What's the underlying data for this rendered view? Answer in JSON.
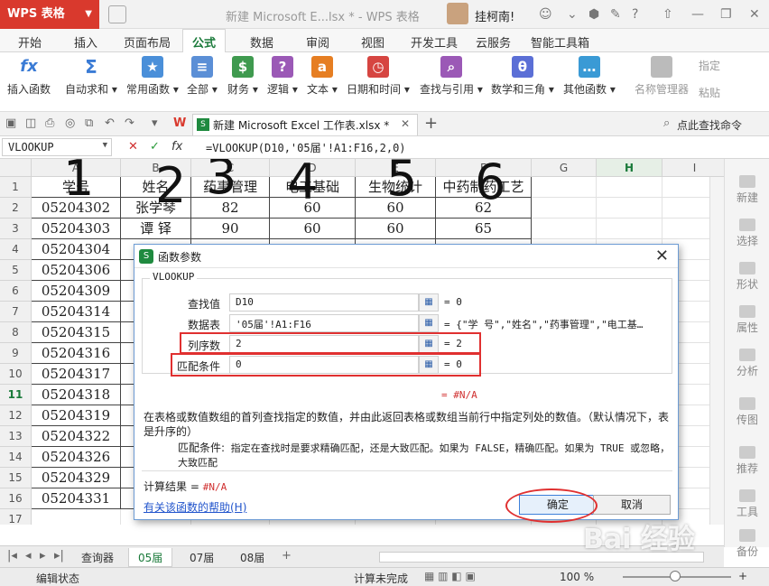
{
  "titlebar": {
    "app": "WPS 表格",
    "doc_title": "新建 Microsoft E...lsx * - WPS 表格",
    "user": "挂柯南!"
  },
  "menu": [
    "开始",
    "插入",
    "页面布局",
    "公式",
    "数据",
    "审阅",
    "视图",
    "开发工具",
    "云服务",
    "智能工具箱"
  ],
  "active_menu": "公式",
  "ribbon": [
    {
      "label": "插入函数",
      "icon": "fx",
      "color": "#3a7bd5"
    },
    {
      "label": "自动求和 ▾",
      "icon": "Σ",
      "color": "#3a7bd5"
    },
    {
      "label": "常用函数 ▾",
      "icon": "★",
      "color": "#4a8fd9"
    },
    {
      "label": "全部 ▾",
      "icon": "≡",
      "color": "#5b8fd6"
    },
    {
      "label": "财务 ▾",
      "icon": "$",
      "color": "#3f9a4f"
    },
    {
      "label": "逻辑 ▾",
      "icon": "?",
      "color": "#9b59b6"
    },
    {
      "label": "文本 ▾",
      "icon": "a",
      "color": "#e67e22"
    },
    {
      "label": "日期和时间 ▾",
      "icon": "◷",
      "color": "#d64541"
    },
    {
      "label": "查找与引用 ▾",
      "icon": "⌕",
      "color": "#9b59b6"
    },
    {
      "label": "数学和三角 ▾",
      "icon": "θ",
      "color": "#5b6fd6"
    },
    {
      "label": "其他函数 ▾",
      "icon": "…",
      "color": "#3a9ad5"
    }
  ],
  "ribbon_right": {
    "name_manager": "名称管理器",
    "paste": "粘贴",
    "specify": "指定"
  },
  "workbook_tab": "新建 Microsoft Excel 工作表.xlsx *",
  "search_cmd": "点此查找命令",
  "namebox": "VLOOKUP",
  "formula": "=VLOOKUP(D10,'05届'!A1:F16,2,0)",
  "columns": [
    "A",
    "B",
    "C",
    "D",
    "E",
    "F",
    "G",
    "H",
    "I"
  ],
  "rows": [
    "1",
    "2",
    "3",
    "4",
    "5",
    "6",
    "7",
    "8",
    "9",
    "10",
    "11",
    "12",
    "13",
    "14",
    "15",
    "16",
    "17"
  ],
  "table": [
    [
      "学号",
      "姓名",
      "药事管理",
      "电工基础",
      "生物统计",
      "中药制药工艺"
    ],
    [
      "05204302",
      "张学琴",
      "82",
      "60",
      "60",
      "62"
    ],
    [
      "05204303",
      "谭 铎",
      "90",
      "60",
      "60",
      "65"
    ],
    [
      "05204304",
      "",
      "",
      "",
      "",
      ""
    ],
    [
      "05204306",
      "",
      "",
      "",
      "",
      ""
    ],
    [
      "05204309",
      "",
      "",
      "",
      "",
      ""
    ],
    [
      "05204314",
      "",
      "",
      "",
      "",
      ""
    ],
    [
      "05204315",
      "",
      "",
      "",
      "",
      ""
    ],
    [
      "05204316",
      "",
      "",
      "",
      "",
      ""
    ],
    [
      "05204317",
      "",
      "",
      "",
      "",
      ""
    ],
    [
      "05204318",
      "",
      "",
      "",
      "",
      ""
    ],
    [
      "05204319",
      "",
      "",
      "",
      "",
      ""
    ],
    [
      "05204322",
      "",
      "",
      "",
      "",
      ""
    ],
    [
      "05204326",
      "",
      "",
      "",
      "",
      ""
    ],
    [
      "05204329",
      "",
      "",
      "",
      "",
      ""
    ],
    [
      "05204331",
      "",
      "",
      "",
      "",
      ""
    ]
  ],
  "handwritten": [
    "1",
    "2",
    "3",
    "4",
    "5",
    "6"
  ],
  "side_panel": [
    "新建",
    "选择",
    "形状",
    "属性",
    "分析",
    "传图",
    "推荐",
    "工具",
    "备份"
  ],
  "sheets": [
    "查询器",
    "05届",
    "07届",
    "08届"
  ],
  "active_sheet": "05届",
  "status": {
    "mode": "编辑状态",
    "calc": "计算未完成",
    "zoom": "100 %"
  },
  "dialog": {
    "title": "函数参数",
    "func": "VLOOKUP",
    "args": [
      {
        "label": "查找值",
        "value": "D10",
        "result": "= 0"
      },
      {
        "label": "数据表",
        "value": "'05届'!A1:F16",
        "result": "= {\"学  号\",\"姓名\",\"药事管理\",\"电工基…"
      },
      {
        "label": "列序数",
        "value": "2",
        "result": "= 2"
      },
      {
        "label": "匹配条件",
        "value": "0",
        "result": "= 0"
      }
    ],
    "result_line": "= #N/A",
    "description": "在表格或数值数组的首列查找指定的数值，并由此返回表格或数组当前行中指定列处的数值。（默认情况下，表是升序的）",
    "param_label": "匹配条件:",
    "param_desc": "指定在查找时是要求精确匹配，还是大致匹配。如果为 FALSE，精确匹配。如果为 TRUE 或忽略，大致匹配",
    "calc_label": "计算结果 =",
    "calc_value": "#N/A",
    "help": "有关该函数的帮助(H)",
    "ok": "确定",
    "cancel": "取消"
  },
  "watermark": "Bai 经验"
}
